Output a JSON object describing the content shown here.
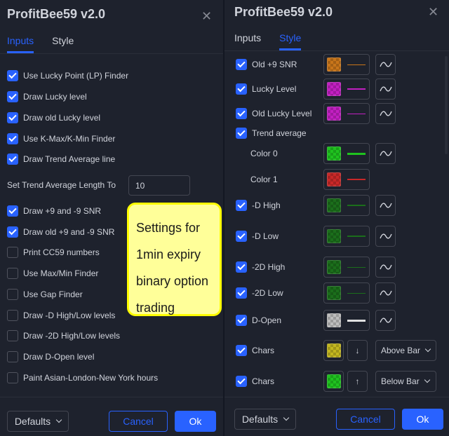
{
  "left": {
    "title": "ProfitBee59 v2.0",
    "tabs": [
      {
        "label": "Inputs",
        "active": true
      },
      {
        "label": "Style",
        "active": false
      }
    ],
    "options": [
      {
        "label": "Use Lucky Point (LP) Finder",
        "checked": true
      },
      {
        "label": "Draw Lucky level",
        "checked": true
      },
      {
        "label": "Draw old Lucky level",
        "checked": true
      },
      {
        "label": "Use K-Max/K-Min Finder",
        "checked": true
      },
      {
        "label": "Draw Trend Average line",
        "checked": true
      }
    ],
    "trend_length": {
      "label": "Set Trend Average Length To",
      "value": "10"
    },
    "options2": [
      {
        "label": "Draw +9 and -9 SNR",
        "checked": true
      },
      {
        "label": "Draw old +9 and -9 SNR",
        "checked": true
      },
      {
        "label": "Print CC59 numbers",
        "checked": false
      },
      {
        "label": "Use Max/Min Finder",
        "checked": false
      },
      {
        "label": "Use Gap Finder",
        "checked": false
      },
      {
        "label": "Draw -D High/Low levels",
        "checked": false
      },
      {
        "label": "Draw -2D High/Low levels",
        "checked": false
      },
      {
        "label": "Draw D-Open level",
        "checked": false
      },
      {
        "label": "Paint Asian-London-New York hours",
        "checked": false
      }
    ],
    "annotation": [
      "Settings for",
      "1min expiry",
      "binary option",
      "trading"
    ],
    "footer": {
      "defaults": "Defaults",
      "cancel": "Cancel",
      "ok": "Ok"
    }
  },
  "right": {
    "title": "ProfitBee59 v2.0",
    "tabs": [
      {
        "label": "Inputs",
        "active": false
      },
      {
        "label": "Style",
        "active": true
      }
    ],
    "rows": [
      {
        "label": "Old +9 SNR",
        "checked": true,
        "color": "#c8751a",
        "line_color": "#c8751a",
        "line_w": 1
      },
      {
        "label": "Lucky Level",
        "checked": true,
        "color": "#c21fc2",
        "line_color": "#c21fc2",
        "line_w": 2
      },
      {
        "label": "Old Lucky Level",
        "checked": true,
        "color": "#c21fc2",
        "line_color": "#c21fc2",
        "line_w": 1
      },
      {
        "label": "Trend average",
        "checked": true
      },
      {
        "label": "Color 0",
        "color": "#1fc21f",
        "line_color": "#1fc21f",
        "line_w": 3
      },
      {
        "label": "Color 1",
        "color": "#c82828",
        "line_color": "#c82828",
        "line_w": 2
      },
      {
        "label": "-D High",
        "checked": true,
        "color": "#1b6e1b",
        "line_color": "#1b6e1b",
        "line_w": 2
      },
      {
        "label": "-D Low",
        "checked": true,
        "color": "#1b6e1b",
        "line_color": "#1b6e1b",
        "line_w": 2
      },
      {
        "label": "-2D High",
        "checked": true,
        "color": "#1b6e1b",
        "line_color": "#1b6e1b",
        "line_w": 1
      },
      {
        "label": "-2D Low",
        "checked": true,
        "color": "#1b6e1b",
        "line_color": "#1b6e1b",
        "line_w": 1
      },
      {
        "label": "D-Open",
        "checked": true,
        "color": "#bdbdbd",
        "line_color": "#e0e0e0",
        "line_w": 3
      },
      {
        "label": "Chars",
        "checked": true,
        "color": "#c2b61f",
        "shape": "↓",
        "location": "Above Bar"
      },
      {
        "label": "Chars",
        "checked": true,
        "color": "#1fc21f",
        "shape": "↑",
        "location": "Below Bar"
      }
    ],
    "footer": {
      "defaults": "Defaults",
      "cancel": "Cancel",
      "ok": "Ok"
    }
  },
  "icons": {
    "close": "close-icon",
    "wave": "wave-icon",
    "chevron": "chevron-down-icon"
  }
}
